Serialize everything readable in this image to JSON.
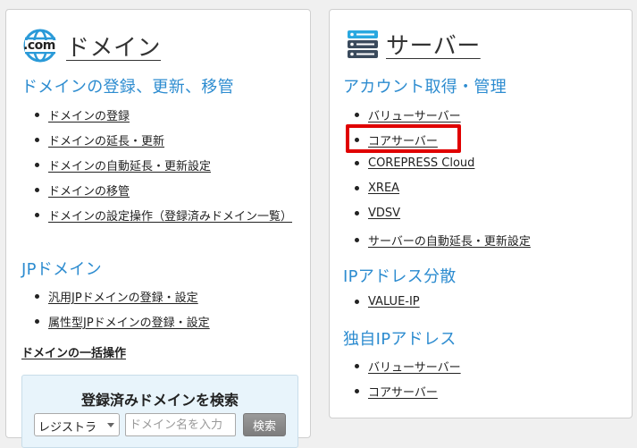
{
  "domain_card": {
    "icon_label": ".com",
    "title": "ドメイン",
    "sections": [
      {
        "heading": "ドメインの登録、更新、移管",
        "items": [
          "ドメインの登録",
          "ドメインの延長・更新",
          "ドメインの自動延長・更新設定",
          "ドメインの移管",
          "ドメインの設定操作（登録済みドメイン一覧）"
        ]
      },
      {
        "heading": "JPドメイン",
        "items": [
          "汎用JPドメインの登録・設定",
          "属性型JPドメインの登録・設定"
        ]
      }
    ],
    "bulk_link": "ドメインの一括操作",
    "search": {
      "title": "登録済みドメインを検索",
      "select_value": "レジストラ",
      "input_placeholder": "ドメイン名を入力",
      "button_label": "検索"
    }
  },
  "server_card": {
    "title": "サーバー",
    "sections": [
      {
        "heading": "アカウント取得・管理",
        "items": [
          "バリューサーバー",
          "コアサーバー",
          "COREPRESS Cloud",
          "XREA",
          "VDSV",
          "サーバーの自動延長・更新設定"
        ]
      },
      {
        "heading": "IPアドレス分散",
        "items": [
          "VALUE-IP"
        ]
      },
      {
        "heading": "独自IPアドレス",
        "items": [
          "バリューサーバー",
          "コアサーバー"
        ]
      }
    ]
  },
  "colors": {
    "heading_blue": "#2d8cd0",
    "highlight_red": "#e00000",
    "server_icon_blue": "#29a8e0",
    "server_icon_dark": "#3a4a5c",
    "globe_blue": "#2a9ad8"
  },
  "highlighted_item": "コアサーバー"
}
